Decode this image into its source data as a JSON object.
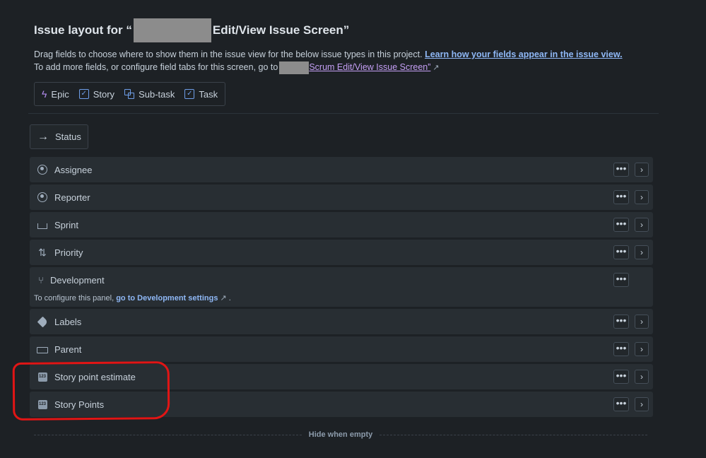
{
  "header": {
    "title_prefix": "Issue layout for “",
    "title_suffix": "Edit/View Issue Screen”"
  },
  "description": {
    "line1_text": "Drag fields to choose where to show them in the issue view for the below issue types in this project.",
    "line1_link": "Learn how your fields appear in the issue view.",
    "line2_text": "To add more fields, or configure field tabs for this screen, go to",
    "line2_link": "Scrum Edit/View Issue Screen”"
  },
  "issue_types": [
    {
      "label": "Epic",
      "icon": "lightning-icon"
    },
    {
      "label": "Story",
      "icon": "checkbox-icon"
    },
    {
      "label": "Sub-task",
      "icon": "subtask-icon"
    },
    {
      "label": "Task",
      "icon": "checkbox-icon"
    }
  ],
  "status": {
    "label": "Status",
    "icon": "arrow-right-icon"
  },
  "fields": [
    {
      "label": "Assignee",
      "icon": "person-icon"
    },
    {
      "label": "Reporter",
      "icon": "person-icon"
    },
    {
      "label": "Sprint",
      "icon": "sprint-icon"
    },
    {
      "label": "Priority",
      "icon": "priority-icon"
    },
    {
      "label": "Development",
      "icon": "branch-icon",
      "subtext": "To configure this panel,",
      "sublink": "go to Development settings",
      "subend": "."
    },
    {
      "label": "Labels",
      "icon": "tag-icon"
    },
    {
      "label": "Parent",
      "icon": "parent-icon"
    },
    {
      "label": "Story point estimate",
      "icon": "number-icon"
    },
    {
      "label": "Story Points",
      "icon": "number-icon"
    }
  ],
  "controls": {
    "more": "•••",
    "chevron": "›",
    "number_badge": "123"
  },
  "footer": {
    "hide_when_empty": "Hide when empty"
  }
}
